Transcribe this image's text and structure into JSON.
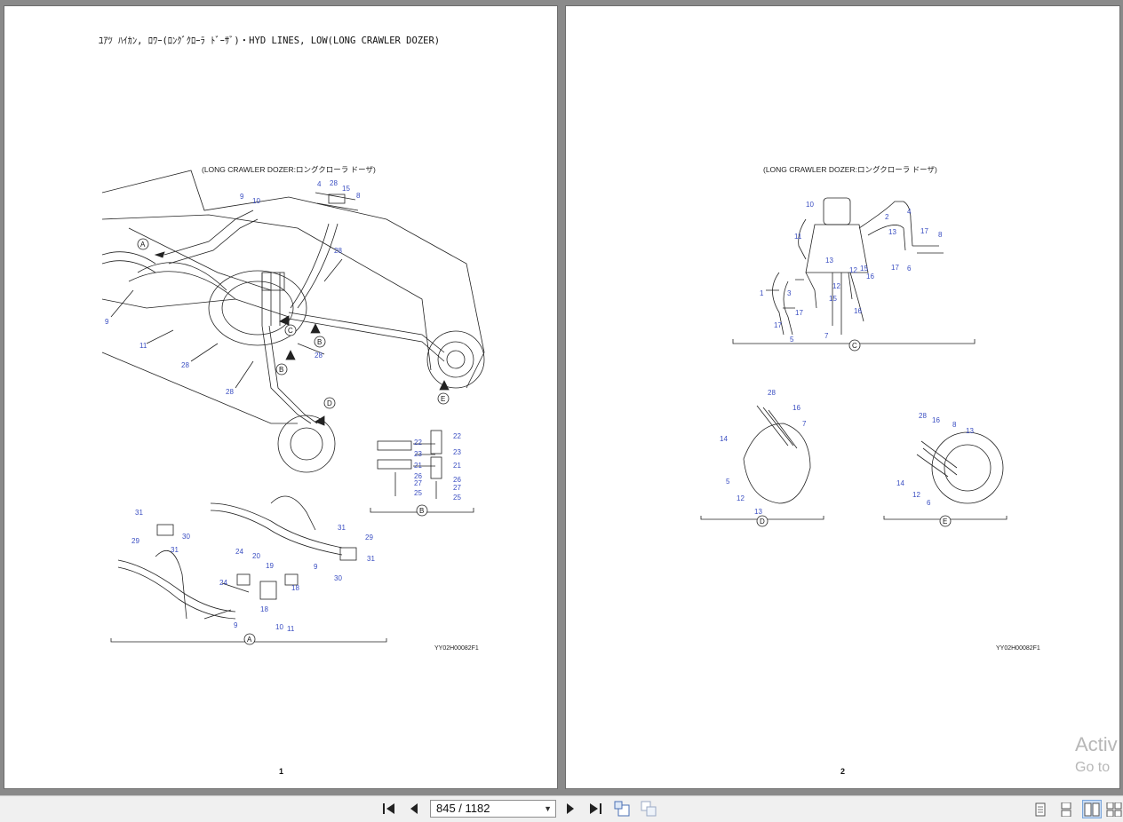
{
  "page1": {
    "title": "ﾕｱﾂ ﾊｲｶﾝ, ﾛﾜｰ(ﾛﾝｸﾞｸﾛｰﾗ ﾄﾞｰｻﾞ)・HYD LINES, LOW(LONG CRAWLER DOZER)",
    "subtitle": "(LONG CRAWLER DOZER:ロングクローラ ドーザ)",
    "drawing_code": "YY02H00082F1",
    "page_number": "1",
    "part_labels_main": [
      "4",
      "28",
      "15",
      "8",
      "9",
      "10",
      "28",
      "9",
      "11",
      "28",
      "28",
      "28"
    ],
    "part_labels_B": [
      "22",
      "23",
      "21",
      "26",
      "27",
      "25",
      "22",
      "23",
      "21",
      "26",
      "27",
      "25"
    ],
    "part_labels_A": [
      "31",
      "29",
      "30",
      "31",
      "24",
      "20",
      "19",
      "24",
      "18",
      "18",
      "9",
      "9",
      "10",
      "11",
      "31",
      "29",
      "31",
      "30"
    ],
    "view_markers": [
      "A",
      "B",
      "B",
      "C",
      "D",
      "E",
      "B",
      "A"
    ]
  },
  "page2": {
    "subtitle": "(LONG CRAWLER DOZER:ロングクローラ ドーザ)",
    "drawing_code": "YY02H00082F1",
    "page_number": "2",
    "part_labels_C": [
      "10",
      "4",
      "2",
      "13",
      "17",
      "8",
      "11",
      "6",
      "13",
      "12",
      "15",
      "16",
      "17",
      "6",
      "1",
      "3",
      "12",
      "15",
      "16",
      "17",
      "17",
      "5",
      "7"
    ],
    "part_labels_D": [
      "28",
      "16",
      "7",
      "14",
      "5",
      "12",
      "13"
    ],
    "part_labels_E": [
      "28",
      "16",
      "8",
      "13",
      "14",
      "12",
      "6"
    ],
    "view_markers": [
      "C",
      "D",
      "E"
    ]
  },
  "watermark": {
    "line1": "Activ",
    "line2": "Go to"
  },
  "toolbar": {
    "first_icon": "first-page-icon",
    "prev_icon": "previous-page-icon",
    "page_field_value": "845 / 1182",
    "next_icon": "next-page-icon",
    "last_icon": "last-page-icon",
    "rotate_icon": "rotate-page-icon",
    "extract_icon": "extract-page-icon",
    "view_modes": [
      "single-page-icon",
      "continuous-icon",
      "two-page-icon",
      "two-page-continuous-icon"
    ],
    "active_view": "two-page-icon",
    "accent": "#c9dcf3"
  }
}
